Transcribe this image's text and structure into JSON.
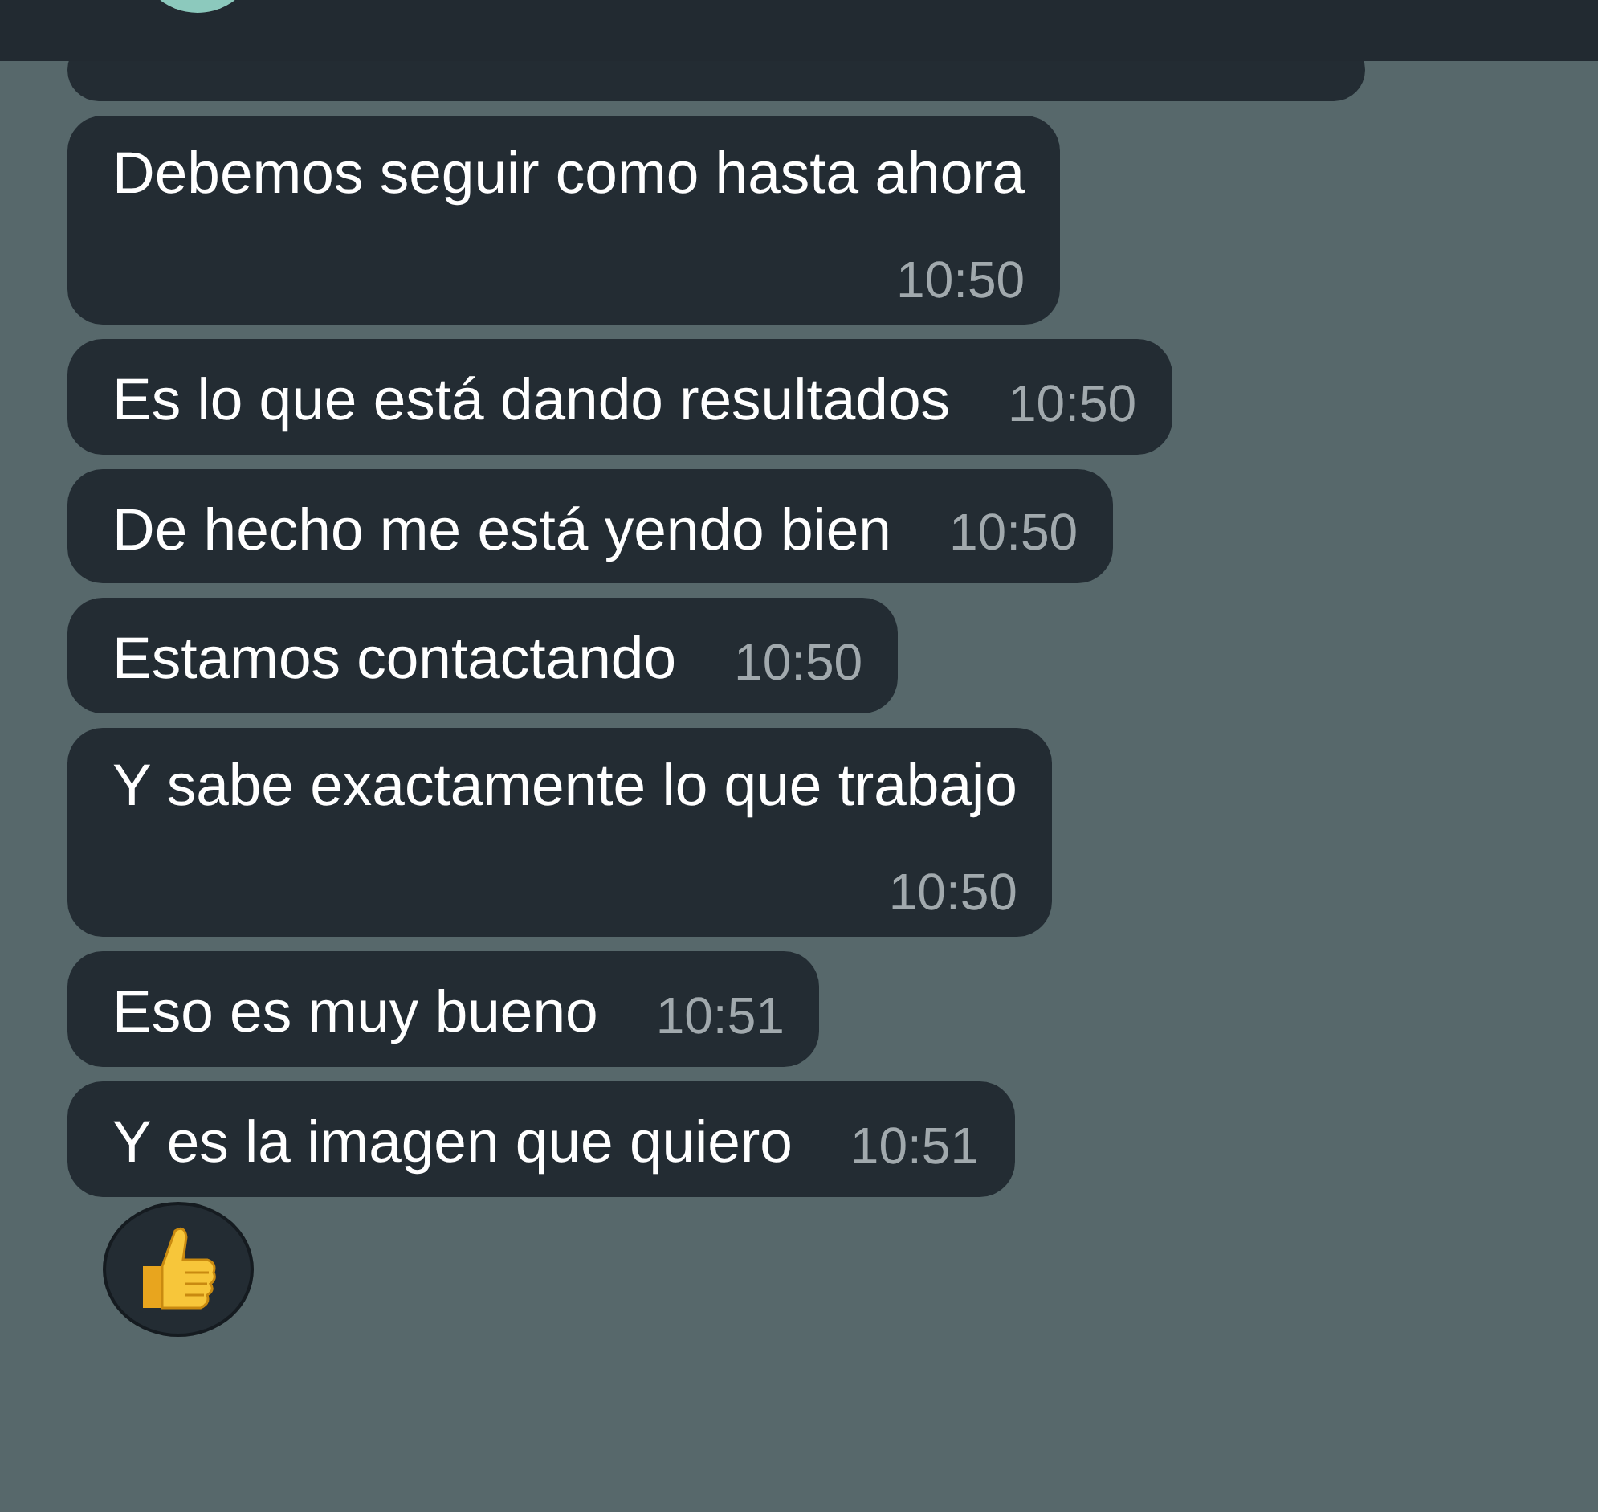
{
  "messages": [
    {
      "kind": "stacked",
      "text": "Debemos seguir como hasta ahora",
      "time": "10:50"
    },
    {
      "kind": "inline",
      "text": "Es lo que está dando resultados",
      "time": "10:50"
    },
    {
      "kind": "inline",
      "text": "De hecho me está yendo bien",
      "time": "10:50"
    },
    {
      "kind": "inline",
      "text": "Estamos contactando",
      "time": "10:50"
    },
    {
      "kind": "stacked",
      "text": "Y sabe exactamente lo que trabajo",
      "time": "10:50"
    },
    {
      "kind": "inline",
      "text": "Eso es muy bueno",
      "time": "10:51"
    },
    {
      "kind": "inline",
      "text": "Y es la imagen que quiero",
      "time": "10:51"
    }
  ]
}
